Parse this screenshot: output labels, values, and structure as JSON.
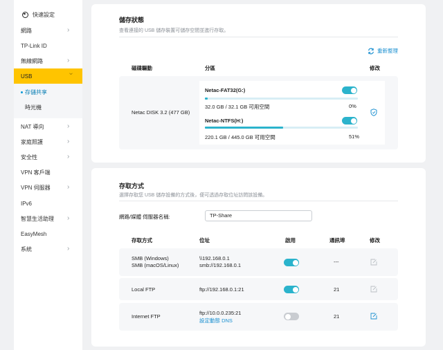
{
  "sidebar": {
    "quick_setup": "快速設定",
    "items": [
      {
        "label": "網路",
        "has_chevron": true
      },
      {
        "label": "TP-Link ID",
        "has_chevron": false
      },
      {
        "label": "無線網路",
        "has_chevron": true
      },
      {
        "label": "USB",
        "has_chevron": true,
        "active": true
      },
      {
        "label": "NAT 導向",
        "has_chevron": true
      },
      {
        "label": "家庭照護",
        "has_chevron": true
      },
      {
        "label": "安全性",
        "has_chevron": true
      },
      {
        "label": "VPN 客戶端",
        "has_chevron": false
      },
      {
        "label": "VPN 伺服器",
        "has_chevron": true
      },
      {
        "label": "IPv6",
        "has_chevron": false
      },
      {
        "label": "智慧生活助理",
        "has_chevron": true
      },
      {
        "label": "EasyMesh",
        "has_chevron": false
      },
      {
        "label": "系統",
        "has_chevron": true
      }
    ],
    "usb_sub": [
      "存儲共享",
      "時光機"
    ]
  },
  "storage": {
    "title": "儲存狀態",
    "desc": "查看連接的 USB 儲存裝置可儲存空間並進行存取。",
    "refresh": "重新整理",
    "headers": {
      "disk": "磁碟驅動",
      "partition": "分區",
      "modify": "修改"
    },
    "disk_name": "Netac DISK 3.2 (477 GB)",
    "partitions": [
      {
        "name": "Netac-FAT32(G:)",
        "usage": "32.0 GB / 32.1 GB 可用空間",
        "percent": "0%",
        "fill": 0.02,
        "enabled": true
      },
      {
        "name": "Netac-NTFS(H:)",
        "usage": "220.1 GB / 445.0 GB 可用空間",
        "percent": "51%",
        "fill": 0.51,
        "enabled": true
      }
    ]
  },
  "access": {
    "title": "存取方式",
    "desc": "選擇存取您 USB 儲存設備的方式後，便可透過存取位址訪問該設備。",
    "server_label": "網路/媒體 伺服器名稱:",
    "server_value": "TP-Share",
    "headers": {
      "method": "存取方式",
      "address": "位址",
      "enable": "啟用",
      "port": "通訊埠",
      "modify": "修改"
    },
    "rows": [
      {
        "method1": "SMB (Windows)",
        "method2": "SMB (macOS/Linux)",
        "addr1": "\\\\192.168.0.1",
        "addr2": "smb://192.168.0.1",
        "enabled": true,
        "port": "---"
      },
      {
        "method1": "Local FTP",
        "addr1": "ftp://192.168.0.1:21",
        "enabled": true,
        "port": "21"
      },
      {
        "method1": "Internet FTP",
        "addr1": "ftp://10.0.0.235:21",
        "addr_link": "設定動態 DNS",
        "enabled": false,
        "port": "21"
      }
    ]
  },
  "colors": {
    "accent": "#2bb3cc",
    "active_nav": "#ffc400",
    "link": "#1a8fd0"
  }
}
